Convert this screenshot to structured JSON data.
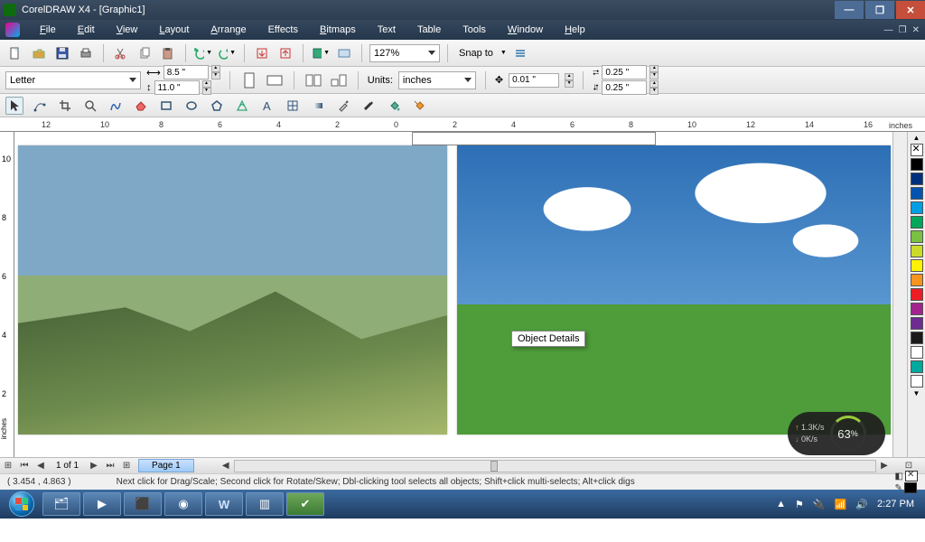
{
  "title": "CorelDRAW X4 - [Graphic1]",
  "menu": [
    "File",
    "Edit",
    "View",
    "Layout",
    "Arrange",
    "Effects",
    "Bitmaps",
    "Text",
    "Table",
    "Tools",
    "Window",
    "Help"
  ],
  "toolbar": {
    "zoom": "127%",
    "snap_label": "Snap to"
  },
  "property": {
    "paper": "Letter",
    "width": "8.5 \"",
    "height": "11.0 \"",
    "units_label": "Units:",
    "units": "inches",
    "nudge": "0.01 \"",
    "dup_x": "0.25 \"",
    "dup_y": "0.25 \""
  },
  "ruler": {
    "unit": "inches",
    "h_ticks": [
      "12",
      "10",
      "8",
      "6",
      "4",
      "2",
      "0",
      "2",
      "4",
      "6",
      "8",
      "10",
      "12",
      "14",
      "16"
    ],
    "v_ticks": [
      "10",
      "8",
      "6",
      "4",
      "2"
    ]
  },
  "tooltip": "Object Details",
  "netmeter": {
    "up": "1.3K/s",
    "down": "0K/s",
    "pct": "63",
    "suffix": "%"
  },
  "palette": [
    "#ffffff",
    "#000000",
    "#00307c",
    "#0054b0",
    "#009fe3",
    "#00a65a",
    "#7ac143",
    "#cbdb2a",
    "#fff200",
    "#f7941e",
    "#ed1c24",
    "#a3238e",
    "#6e2b90",
    "#1a1a1a",
    "#ffffff",
    "#00a99d"
  ],
  "pager": {
    "pos": "1 of 1",
    "tab": "Page 1"
  },
  "status": {
    "coords": "( 3.454 , 4.863 )",
    "hint": "Next click for Drag/Scale; Second click for Rotate/Skew; Dbl-clicking tool selects all objects; Shift+click multi-selects; Alt+click digs"
  },
  "clock": "2:27 PM"
}
